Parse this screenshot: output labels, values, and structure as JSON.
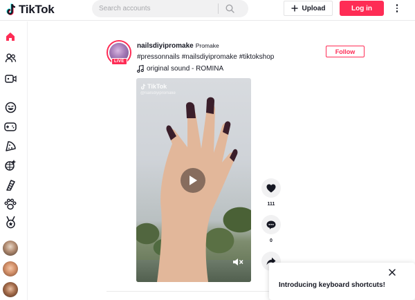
{
  "header": {
    "logo_text": "TikTok",
    "search_placeholder": "Search accounts",
    "upload_label": "Upload",
    "login_label": "Log in"
  },
  "sidebar": {
    "items": [
      {
        "icon": "home-icon",
        "active": true
      },
      {
        "icon": "following-icon"
      },
      {
        "icon": "live-icon"
      },
      {
        "icon": "comedy-icon"
      },
      {
        "icon": "gaming-icon"
      },
      {
        "icon": "food-icon"
      },
      {
        "icon": "dance-icon"
      },
      {
        "icon": "beauty-icon"
      },
      {
        "icon": "animals-icon"
      },
      {
        "icon": "sports-icon"
      }
    ]
  },
  "post": {
    "live_badge": "LIVE",
    "username": "nailsdiyipromake",
    "nickname": "Promake",
    "hashtags": [
      "#pressonnails",
      "#nailsdiyipromake",
      "#tiktokshop"
    ],
    "sound": "original sound - ROMINA",
    "follow_label": "Follow",
    "video_watermark": "TikTok",
    "video_watermark_handle": "@nailsdiyipromake",
    "likes": "111",
    "comments": "0"
  },
  "toast": {
    "text": "Introducing keyboard shortcuts!"
  },
  "colors": {
    "brand": "#fe2c55",
    "text": "#161823"
  }
}
